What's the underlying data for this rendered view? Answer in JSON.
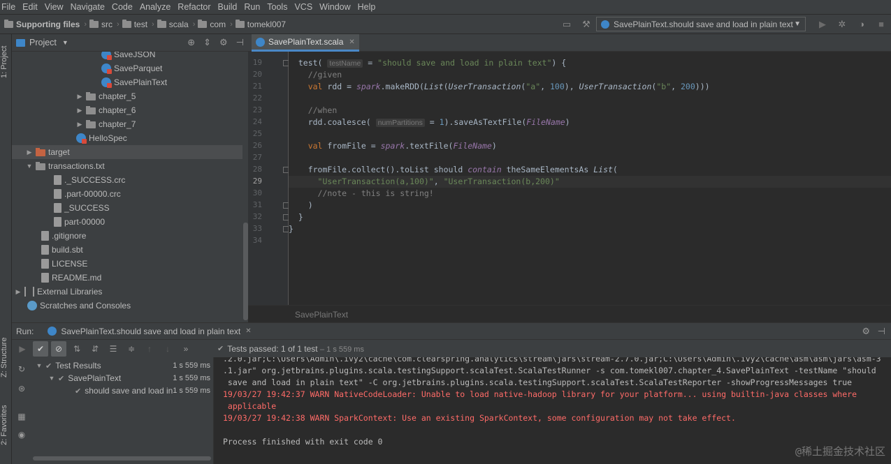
{
  "menu": [
    "File",
    "Edit",
    "View",
    "Navigate",
    "Code",
    "Analyze",
    "Refactor",
    "Build",
    "Run",
    "Tools",
    "VCS",
    "Window",
    "Help"
  ],
  "breadcrumbs": [
    "Supporting files",
    "src",
    "test",
    "scala",
    "com",
    "tomekl007"
  ],
  "run_config": "SavePlainText.should save and load in plain text",
  "left_tabs": {
    "project": "1: Project",
    "structure": "Z: Structure",
    "favorites": "2: Favorites"
  },
  "project_panel": {
    "title": "Project",
    "tree": [
      {
        "label": "SaveJSON",
        "icon": "scala-icon"
      },
      {
        "label": "SaveParquet",
        "icon": "scala-icon"
      },
      {
        "label": "SavePlainText",
        "icon": "scala-icon"
      },
      {
        "label": "chapter_5",
        "icon": "folder-icon"
      },
      {
        "label": "chapter_6",
        "icon": "folder-icon"
      },
      {
        "label": "chapter_7",
        "icon": "folder-icon"
      },
      {
        "label": "HelloSpec",
        "icon": "scala-icon"
      },
      {
        "label": "target",
        "icon": "folder-icon"
      },
      {
        "label": "transactions.txt",
        "icon": "folder-icon"
      },
      {
        "label": "._SUCCESS.crc",
        "icon": "file-icon"
      },
      {
        "label": ".part-00000.crc",
        "icon": "file-icon"
      },
      {
        "label": "_SUCCESS",
        "icon": "file-icon"
      },
      {
        "label": "part-00000",
        "icon": "file-icon"
      },
      {
        "label": ".gitignore",
        "icon": "file-icon"
      },
      {
        "label": "build.sbt",
        "icon": "file-icon"
      },
      {
        "label": "LICENSE",
        "icon": "file-icon"
      },
      {
        "label": "README.md",
        "icon": "file-icon"
      },
      {
        "label": "External Libraries",
        "icon": "library-icon"
      },
      {
        "label": "Scratches and Consoles",
        "icon": "scratch-icon"
      }
    ]
  },
  "editor": {
    "tab": "SavePlainText.scala",
    "breadcrumb": "SavePlainText",
    "line_numbers": [
      "19",
      "20",
      "21",
      "22",
      "23",
      "24",
      "25",
      "26",
      "27",
      "28",
      "29",
      "30",
      "31",
      "32",
      "33",
      "34"
    ],
    "hints": {
      "testName": "testName",
      "numPartitions": "numPartitions"
    }
  },
  "run_panel": {
    "label": "Run:",
    "tab": "SavePlainText.should save and load in plain text",
    "status": "Tests passed:",
    "status_count": "1 of 1 test",
    "status_time": "– 1 s 559 ms",
    "tests": [
      {
        "label": "Test Results",
        "time": "1 s 559 ms"
      },
      {
        "label": "SavePlainText",
        "time": "1 s 559 ms"
      },
      {
        "label": "should save and load in",
        "time": "1 s 559 ms"
      }
    ],
    "console": [
      ".2.0.jar;C:\\Users\\Admin\\.ivy2\\cache\\com.clearspring.analytics\\stream\\jars\\stream-2.7.0.jar;C:\\Users\\Admin\\.ivy2\\cache\\asm\\asm\\jars\\asm-3",
      ".1.jar\" org.jetbrains.plugins.scala.testingSupport.scalaTest.ScalaTestRunner -s com.tomekl007.chapter_4.SavePlainText -testName \"should",
      " save and load in plain text\" -C org.jetbrains.plugins.scala.testingSupport.scalaTest.ScalaTestReporter -showProgressMessages true",
      "19/03/27 19:42:37 WARN NativeCodeLoader: Unable to load native-hadoop library for your platform... using builtin-java classes where",
      " applicable",
      "19/03/27 19:42:38 WARN SparkContext: Use an existing SparkContext, some configuration may not take effect.",
      "",
      "Process finished with exit code 0"
    ]
  },
  "watermark": "@稀土掘金技术社区"
}
